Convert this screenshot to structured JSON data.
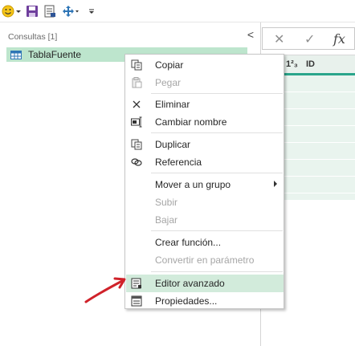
{
  "quick_access": {
    "icons": [
      "smiley-icon",
      "dropdown-icon",
      "save-icon",
      "report-icon",
      "move-icon",
      "customize-icon"
    ]
  },
  "queries_pane": {
    "header": "Consultas [1]",
    "collapse_glyph": "<",
    "items": [
      {
        "name": "TablaFuente",
        "icon": "table-icon"
      }
    ]
  },
  "formula_bar": {
    "cancel_glyph": "✕",
    "confirm_glyph": "✓",
    "fx_glyph": "fx"
  },
  "grid": {
    "column": {
      "type_label": "1²₃",
      "name": "ID"
    },
    "row_count": 7
  },
  "context_menu": {
    "items": [
      {
        "label": "Copiar",
        "icon": "copy-icon",
        "enabled": true
      },
      {
        "label": "Pegar",
        "icon": "paste-icon",
        "enabled": false
      },
      {
        "label": "Eliminar",
        "icon": "delete-icon",
        "enabled": true
      },
      {
        "label": "Cambiar nombre",
        "icon": "rename-icon",
        "enabled": true
      },
      {
        "label": "Duplicar",
        "icon": "duplicate-icon",
        "enabled": true
      },
      {
        "label": "Referencia",
        "icon": "reference-icon",
        "enabled": true
      },
      {
        "label": "Mover a un grupo",
        "icon": "",
        "enabled": true,
        "submenu": true
      },
      {
        "label": "Subir",
        "icon": "",
        "enabled": false
      },
      {
        "label": "Bajar",
        "icon": "",
        "enabled": false
      },
      {
        "label": "Crear función...",
        "icon": "",
        "enabled": true
      },
      {
        "label": "Convertir en parámetro",
        "icon": "",
        "enabled": false
      },
      {
        "label": "Editor avanzado",
        "icon": "advanced-editor-icon",
        "enabled": true,
        "highlighted": true
      },
      {
        "label": "Propiedades...",
        "icon": "properties-icon",
        "enabled": true
      }
    ]
  },
  "colors": {
    "accent_green": "#2aa58b",
    "selection_green": "#bde5cd",
    "hover_green": "#d2ebdb",
    "annotation_red": "#d0222a"
  }
}
